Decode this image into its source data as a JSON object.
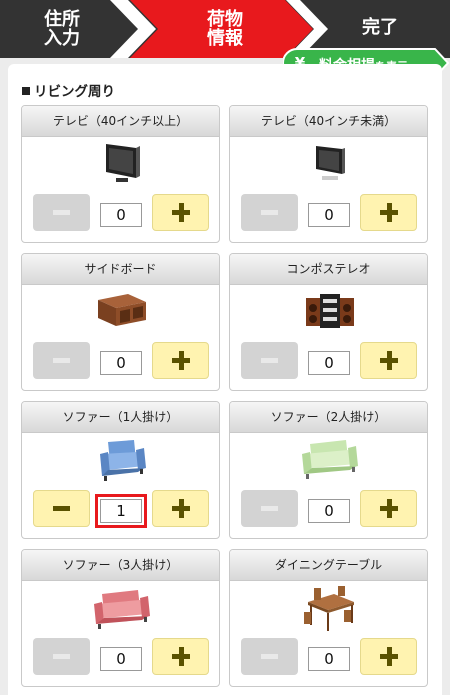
{
  "steps": {
    "step1": "住所\n入力",
    "step2": "荷物\n情報",
    "step3": "完了"
  },
  "price_button": {
    "icon": "yen-icon",
    "label": "料金相場",
    "suffix": "を表示"
  },
  "section": {
    "title": "リビング周り"
  },
  "items": [
    {
      "name": "テレビ（40インチ以上）",
      "qty": "0",
      "icon": "tv-large-icon"
    },
    {
      "name": "テレビ（40インチ未満）",
      "qty": "0",
      "icon": "tv-small-icon"
    },
    {
      "name": "サイドボード",
      "qty": "0",
      "icon": "sideboard-icon"
    },
    {
      "name": "コンポステレオ",
      "qty": "0",
      "icon": "stereo-icon"
    },
    {
      "name": "ソファー（1人掛け）",
      "qty": "1",
      "icon": "sofa-1-seat-icon"
    },
    {
      "name": "ソファー（2人掛け）",
      "qty": "0",
      "icon": "sofa-2-seat-icon"
    },
    {
      "name": "ソファー（3人掛け）",
      "qty": "0",
      "icon": "sofa-3-seat-icon"
    },
    {
      "name": "ダイニングテーブル",
      "qty": "0",
      "icon": "dining-table-icon"
    }
  ],
  "colors": {
    "header_dark": "#333333",
    "header_active": "#e8191d",
    "price_green": "#39b54a",
    "plus_bg": "#fff3b0",
    "highlight": "#e8191d"
  }
}
